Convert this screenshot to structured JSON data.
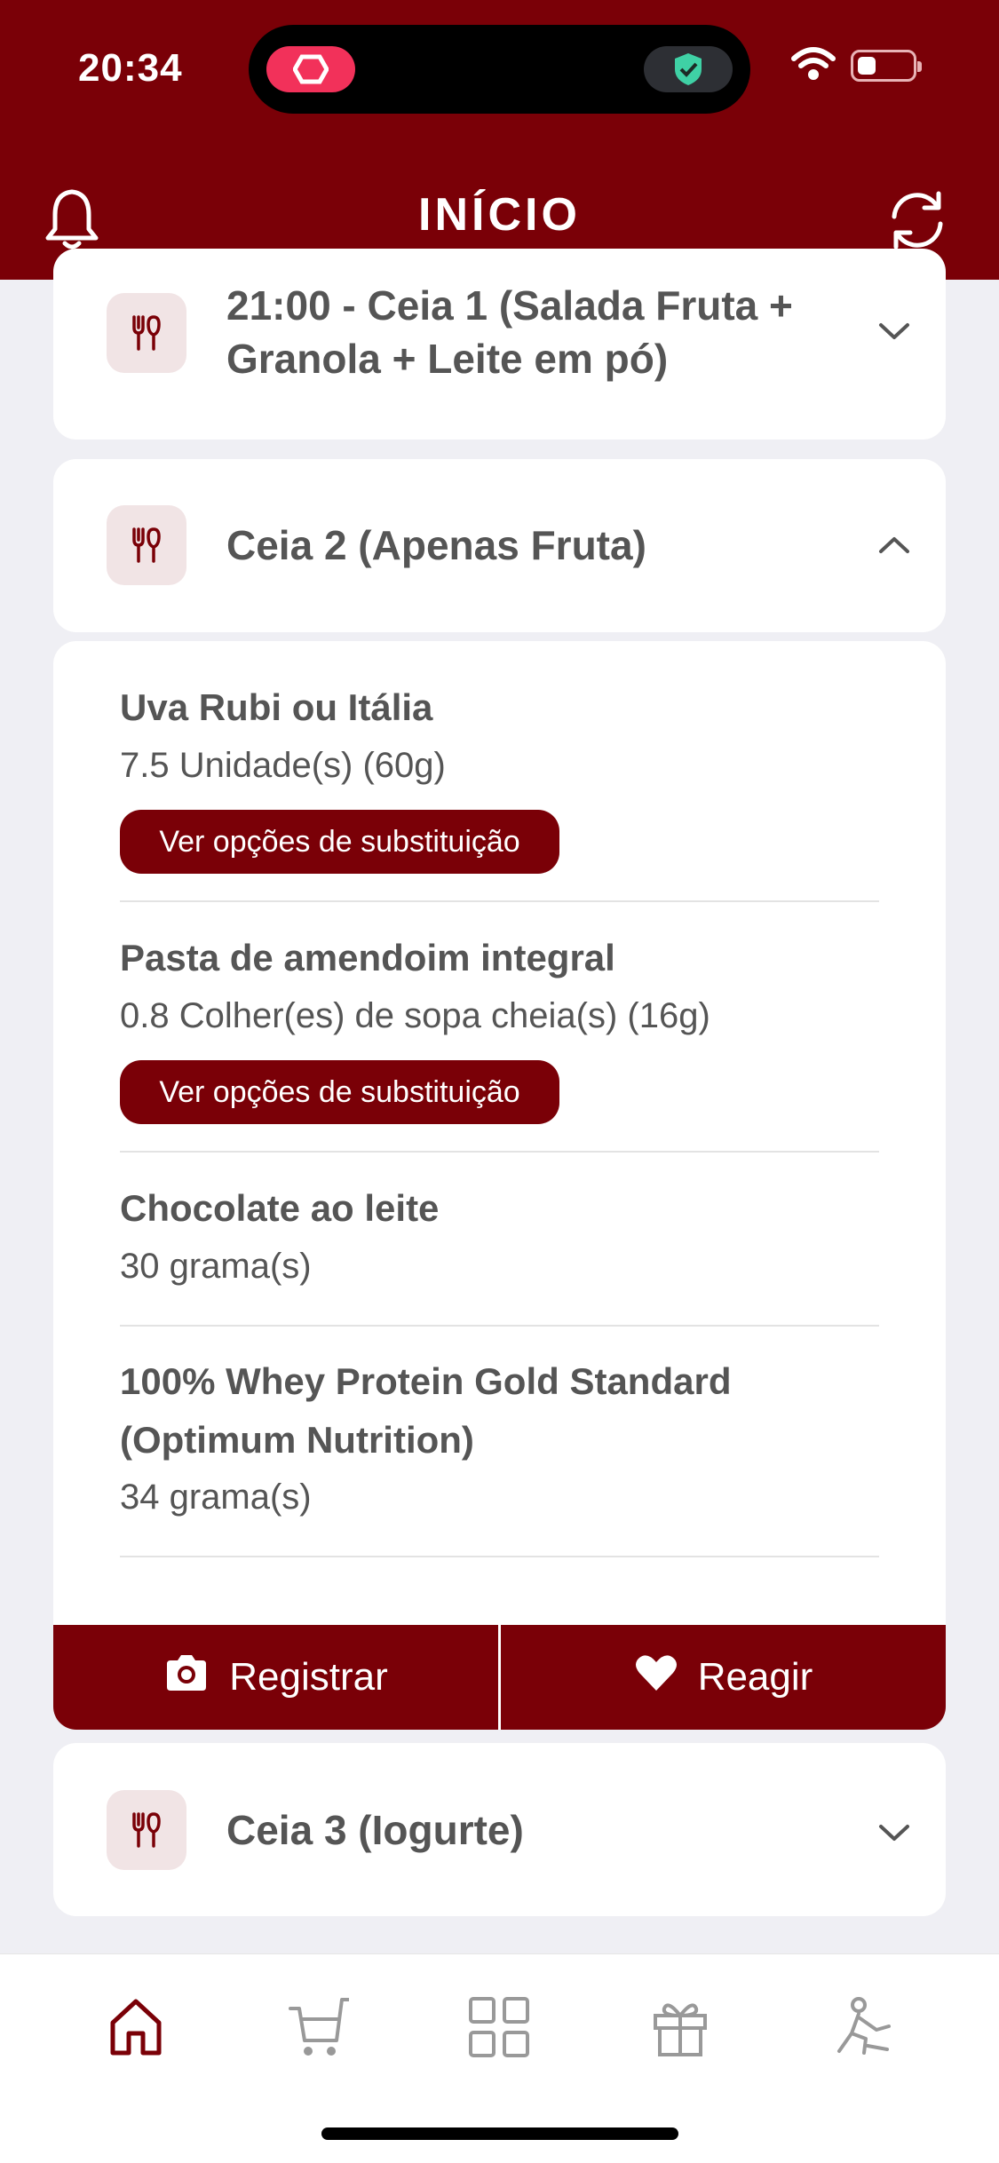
{
  "status_bar": {
    "time": "20:34"
  },
  "header": {
    "title": "INÍCIO"
  },
  "meals": [
    {
      "title": "21:00 - Ceia 1 (Salada Fruta + Granola + Leite em pó)",
      "title_line1": "21:00 - Ceia 1 (Salada Fruta +",
      "title_line2": "Granola + Leite em pó)",
      "expanded": false
    },
    {
      "title": "Ceia 2 (Apenas Fruta)",
      "expanded": true
    },
    {
      "title": "Ceia 3 (Iogurte)",
      "expanded": false
    }
  ],
  "foods": [
    {
      "name": "Uva Rubi ou Itália",
      "quantity": "7.5 Unidade(s) (60g)",
      "substitution_label": "Ver opções de substituição"
    },
    {
      "name": "Pasta de amendoim integral",
      "quantity": "0.8 Colher(es) de sopa cheia(s) (16g)",
      "substitution_label": "Ver opções de substituição"
    },
    {
      "name": "Chocolate ao leite",
      "quantity": "30 grama(s)"
    },
    {
      "name": "100% Whey Protein Gold Standard (Optimum Nutrition)",
      "name_line1": "100% Whey Protein Gold Standard",
      "name_line2": "(Optimum Nutrition)",
      "quantity": "34 grama(s)"
    }
  ],
  "actions": {
    "register_label": "Registrar",
    "react_label": "Reagir"
  },
  "tabbar": {
    "items": [
      "home-icon",
      "cart-icon",
      "grid-icon",
      "gift-icon",
      "exercise-icon"
    ],
    "active": "home-icon"
  },
  "colors": {
    "brand": "#7a0007",
    "background": "#efeff4",
    "card": "#ffffff",
    "icon_bg": "#f1e4e5"
  }
}
